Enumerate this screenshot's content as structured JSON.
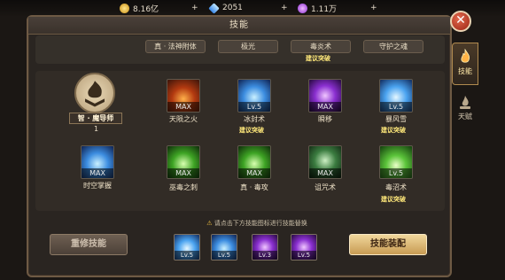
{
  "currencies": [
    {
      "icon": "gold-coin-icon",
      "value": "8.16亿"
    },
    {
      "icon": "diamond-icon",
      "value": "2051"
    },
    {
      "icon": "purple-gem-icon",
      "value": "1.11万"
    }
  ],
  "plus_label": "+",
  "panel": {
    "title": "技能",
    "close": "✕"
  },
  "passives": [
    {
      "label": "真 · 法神附体"
    },
    {
      "label": "极光"
    },
    {
      "label": "毒炎术"
    },
    {
      "label": "守护之魂"
    }
  ],
  "recommend_text": "建议突破",
  "side_tabs": {
    "skill": "技能",
    "talent": "天赋"
  },
  "class_info": {
    "name": "智 · 魔导师",
    "sub_label": "1"
  },
  "skills": [
    {
      "name": "天陨之火",
      "level": "MAX",
      "icon": "meteor-fire-icon"
    },
    {
      "name": "冰封术",
      "level": "Lv.5",
      "icon": "ice-seal-icon"
    },
    {
      "name": "瞬移",
      "level": "MAX",
      "icon": "teleport-icon"
    },
    {
      "name": "暴风雪",
      "level": "Lv.5",
      "icon": "blizzard-icon"
    },
    {
      "name": "时空掌握",
      "level": "MAX",
      "icon": "time-space-icon"
    },
    {
      "name": "巫毒之刺",
      "level": "MAX",
      "icon": "voodoo-thorn-icon"
    },
    {
      "name": "真 · 毒攻",
      "level": "MAX",
      "icon": "poison-attack-icon"
    },
    {
      "name": "诅咒术",
      "level": "MAX",
      "icon": "curse-icon"
    },
    {
      "name": "毒沼术",
      "level": "Lv.5",
      "icon": "poison-swamp-icon"
    }
  ],
  "hint_text": "请点击下方技能图标进行技能替换",
  "equipped": [
    {
      "level": "Lv.5",
      "icon": "blizzard-icon"
    },
    {
      "level": "Lv.5",
      "icon": "ice-seal-icon"
    },
    {
      "level": "Lv.3",
      "icon": "dark-orb-icon"
    },
    {
      "level": "Lv.5",
      "icon": "teleport-icon"
    }
  ],
  "buttons": {
    "reset": "重修技能",
    "config": "技能装配"
  }
}
